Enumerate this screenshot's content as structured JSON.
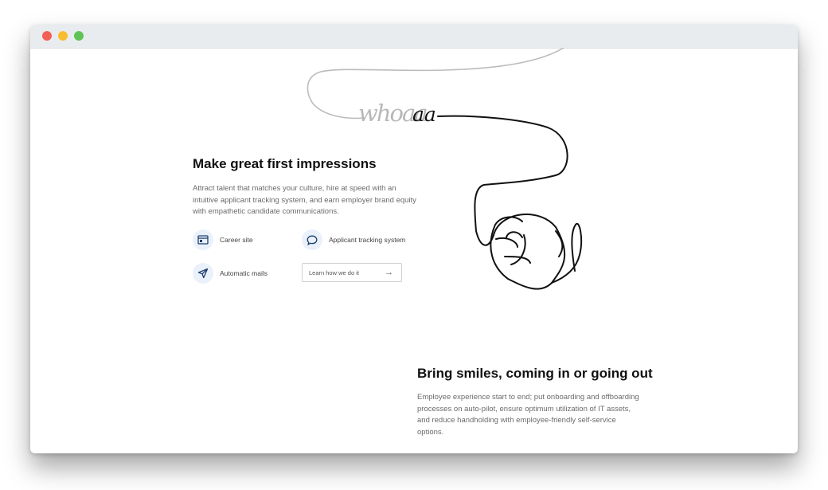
{
  "window": {
    "traffic_lights": [
      "close",
      "minimize",
      "maximize"
    ],
    "colors": {
      "close": "#f25f58",
      "minimize": "#f8bd2f",
      "maximize": "#5fc454"
    }
  },
  "illustration": {
    "handwritten_word": "whoaa",
    "icon": "line-drawing-face"
  },
  "section1": {
    "heading": "Make great first impressions",
    "paragraph_lines": [
      "Attract talent that matches your culture, hire at speed with an",
      "intuitive applicant tracking system, and earn employer brand equity",
      "with empathetic candidate communications."
    ],
    "features": [
      {
        "label": "Career site",
        "icon": "browser-window-icon"
      },
      {
        "label": "Applicant tracking system",
        "icon": "chat-bubble-icon"
      },
      {
        "label": "Automatic mails",
        "icon": "paper-plane-icon"
      }
    ],
    "cta": {
      "label": "Learn how we do it",
      "arrow": "→"
    }
  },
  "section2": {
    "heading": "Bring smiles, coming in or going out",
    "paragraph_lines": [
      "Employee experience start to end; put onboarding and offboarding",
      "processes on auto-pilot, ensure optimum utilization of IT assets,",
      "and reduce handholding with employee-friendly self-service",
      "options."
    ]
  },
  "colors": {
    "heading": "#111111",
    "body_text": "#6b6b6b",
    "icon_bg": "#eaf1fb",
    "icon_stroke": "#1e3d6b",
    "line_art": "#111111",
    "line_art_faded": "#bbbbbb"
  }
}
